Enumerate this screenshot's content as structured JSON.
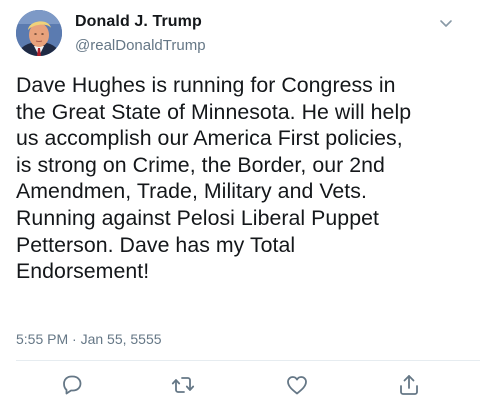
{
  "author": {
    "display_name": "Donald J. Trump",
    "handle": "@realDonaldTrump",
    "avatar_icon": "profile-photo"
  },
  "tweet": {
    "text": "Dave Hughes is running for Congress in\nthe Great State of Minnesota. He will help\nus accomplish our America First policies,\nis strong on Crime, the Border, our 2nd\nAmendmen, Trade, Military and Vets.\nRunning against Pelosi Liberal Puppet\nPetterson. Dave has my Total\nEndorsement!",
    "timestamp": "5:55 PM · Jan 55, 5555"
  },
  "actions": {
    "reply_icon": "reply-icon",
    "retweet_icon": "retweet-icon",
    "like_icon": "like-icon",
    "share_icon": "share-icon",
    "menu_icon": "chevron-down-icon"
  },
  "colors": {
    "text": "#14171a",
    "secondary": "#657786",
    "divider": "#e6ecf0"
  }
}
